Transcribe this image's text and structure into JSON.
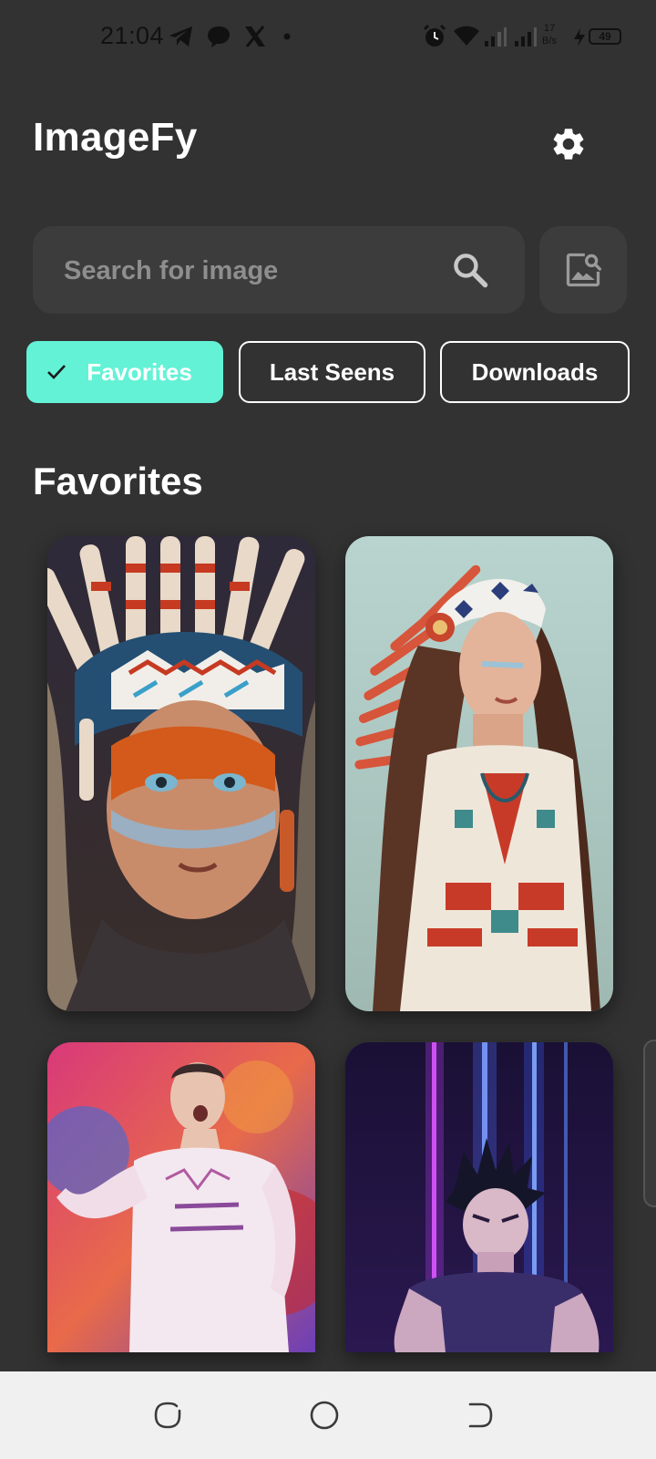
{
  "status_bar": {
    "time": "21:04",
    "speed_value": "17",
    "speed_unit": "B/s",
    "battery": "49",
    "icons": [
      "telegram-icon",
      "chat-icon",
      "x-icon",
      "dot-icon",
      "alarm-icon",
      "wifi-icon",
      "signal-icon",
      "signal-icon",
      "charging-icon",
      "battery-icon"
    ]
  },
  "header": {
    "title": "ImageFy",
    "settings_icon": "gear-icon"
  },
  "search": {
    "placeholder": "Search for image",
    "value": "",
    "icon": "search-icon",
    "image_search_icon": "image-search-icon"
  },
  "chips": [
    {
      "label": "Favorites",
      "selected": true,
      "icon": "check-icon"
    },
    {
      "label": "Last Seens",
      "selected": false
    },
    {
      "label": "Downloads",
      "selected": false
    }
  ],
  "section": {
    "title": "Favorites"
  },
  "gallery": [
    {
      "subject": "woman with feather headdress, face paint"
    },
    {
      "subject": "woman with feather headdress, long hair"
    },
    {
      "subject": "football player on colorful background"
    },
    {
      "subject": "anime character with neon light beams"
    }
  ],
  "nav_bar": {
    "icons": [
      "recents-icon",
      "home-icon",
      "back-icon"
    ]
  },
  "colors": {
    "background": "#323232",
    "surface": "#3c3c3c",
    "accent": "#63f2d6",
    "nav_background": "#f0f0f0"
  }
}
